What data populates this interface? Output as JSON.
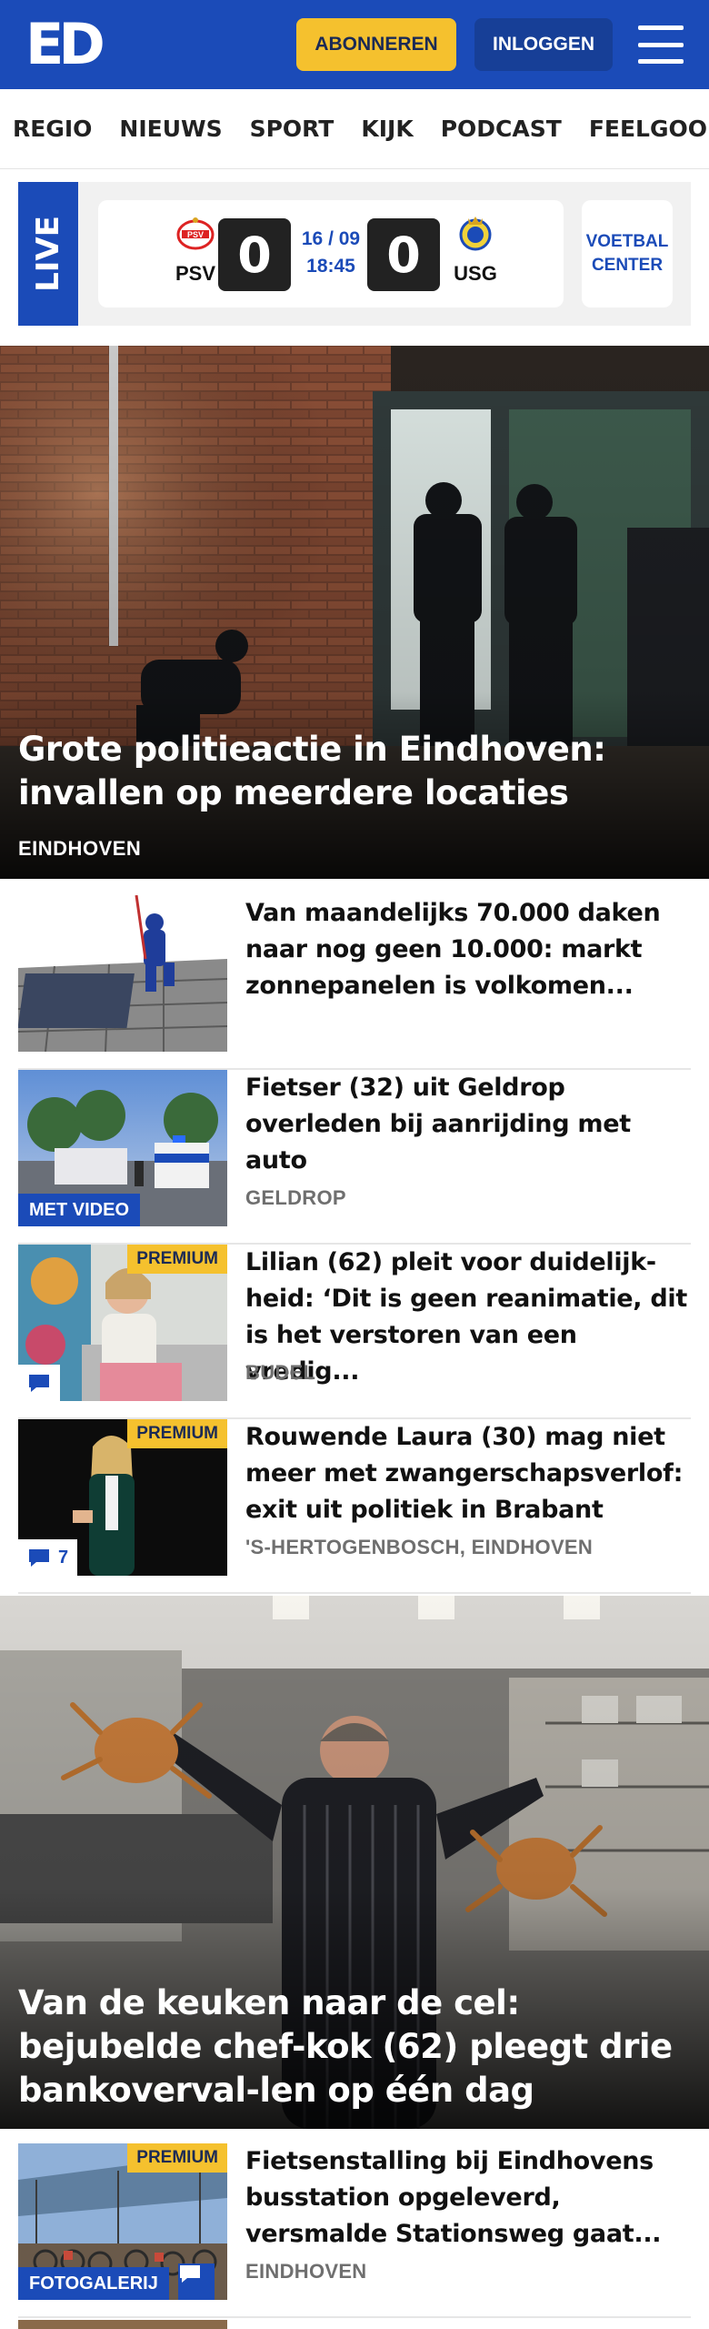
{
  "header": {
    "logo": "ED",
    "subscribe_label": "ABONNEREN",
    "login_label": "INLOGGEN"
  },
  "nav": [
    "REGIO",
    "NIEUWS",
    "SPORT",
    "KIJK",
    "PODCAST",
    "FEELGOOD"
  ],
  "live": {
    "tag": "LIVE",
    "home_team": "PSV",
    "away_team": "USG",
    "home_score": "0",
    "away_score": "0",
    "date": "16 / 09",
    "time": "18:45",
    "center_line1": "VOETBAL",
    "center_line2": "CENTER"
  },
  "hero1": {
    "title": "Grote politieactie in Eindhoven: invallen op meerdere locaties",
    "location": "EINDHOVEN"
  },
  "articles": [
    {
      "title": "Van maandelijks 70.000 daken naar nog geen 10.000: markt zonnepanelen is volkomen...",
      "location": "",
      "premium": "",
      "badge": "",
      "comments": ""
    },
    {
      "title": "Fietser (32) uit Geldrop overleden bij aanrijding met auto",
      "location": "GELDROP",
      "premium": "",
      "badge": "MET VIDEO",
      "comments": ""
    },
    {
      "title": "Lilian (62) pleit voor duidelijk-heid: ‘Dit is geen reanimatie, dit is het verstoren van een vredig...",
      "location": "BUDEL",
      "premium": "PREMIUM",
      "badge": "",
      "comments": ""
    },
    {
      "title": "Rouwende Laura (30) mag niet meer met zwangerschapsverlof: exit uit politiek in Brabant",
      "location": "'S-HERTOGENBOSCH, EINDHOVEN",
      "premium": "PREMIUM",
      "badge": "",
      "comments": "7"
    }
  ],
  "hero2": {
    "title": "Van de keuken naar de cel: bejubelde chef-kok (62) pleegt drie bankoverval-len op één dag"
  },
  "articles2": [
    {
      "title": "Fietsenstalling bij Eindhovens busstation opgeleverd, versmalde Stationsweg gaat...",
      "location": "EINDHOVEN",
      "premium": "PREMIUM",
      "badge": "FOTOGALERIJ"
    }
  ],
  "colors": {
    "brand_blue": "#1b4bb8",
    "premium_yellow": "#f5c12e"
  }
}
